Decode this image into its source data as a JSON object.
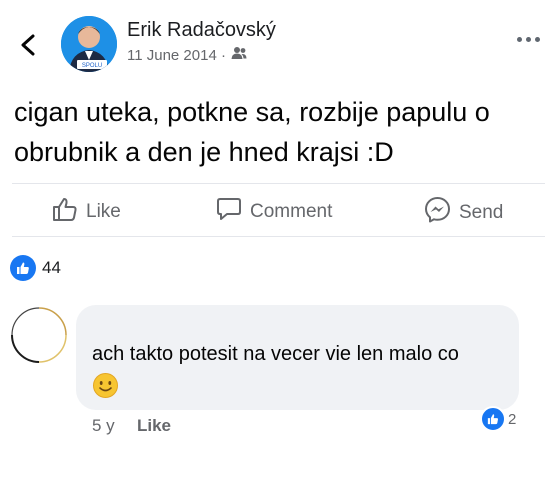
{
  "header": {
    "author_name": "Erik Radačovský",
    "date": "11 June 2014 ·",
    "audience_icon": "friends-icon",
    "avatar_badge": "SPOLU"
  },
  "post": {
    "text": "cigan uteka, potkne sa, rozbije papulu o obrubnik a den je hned krajsi :D"
  },
  "actions": {
    "like_label": "Like",
    "comment_label": "Comment",
    "send_label": "Send"
  },
  "reactions": {
    "count": "44"
  },
  "comment": {
    "text": "ach takto potesit na vecer vie len malo co",
    "time": "5 y",
    "like_label": "Like",
    "reaction_count": "2"
  },
  "colors": {
    "accent": "#1877f2",
    "secondary_text": "#65676b",
    "bubble_bg": "#f0f2f5"
  }
}
